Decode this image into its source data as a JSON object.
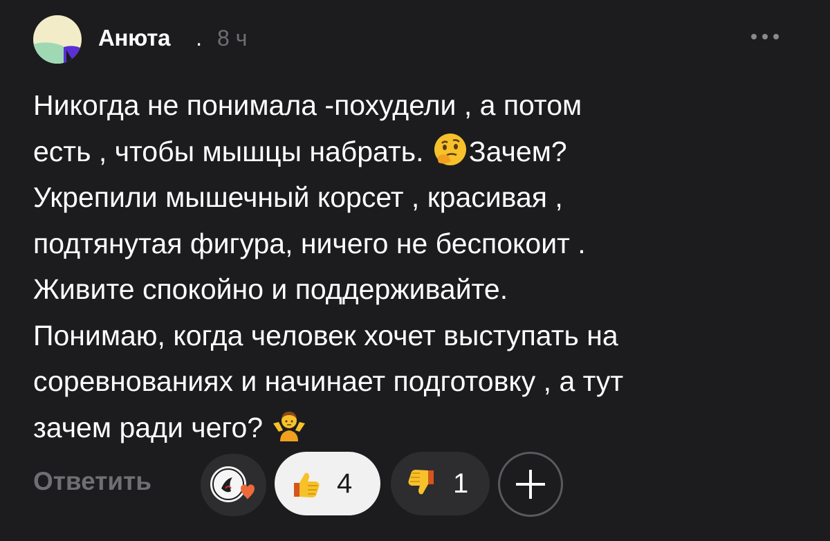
{
  "header": {
    "author_name": "Анюта",
    "separator": ".",
    "timestamp": "8 ч",
    "more_icon": "more-dots-icon"
  },
  "comment": {
    "lines": [
      "Никогда не понимала -похудели , а потом",
      "есть , чтобы мышцы набрать. ",
      "Зачем?",
      "Укрепили мышечный корсет , красивая ,",
      "подтянутая фигура, ничего не беспокоит .",
      "Живите спокойно и поддерживайте.",
      "Понимаю, когда человек хочет выступать на",
      "соревнованиях и начинает подготовку , а тут",
      "зачем ради чего? "
    ],
    "emojis": [
      "thinking-face-emoji",
      "person-shrugging-emoji"
    ]
  },
  "footer": {
    "reply_label": "Ответить",
    "reacted_users_icon": "reaction-avatars-icon",
    "like": {
      "icon": "thumbs-up-icon",
      "count": "4",
      "active": true
    },
    "dislike": {
      "icon": "thumbs-down-icon",
      "count": "1",
      "active": false
    },
    "add_reaction_icon": "plus-icon"
  },
  "colors": {
    "background": "#1c1c1e",
    "text": "#ffffff",
    "muted": "#6f6f73",
    "like_pill": "#f1f1f1",
    "pill_dark": "#2d2d30"
  }
}
